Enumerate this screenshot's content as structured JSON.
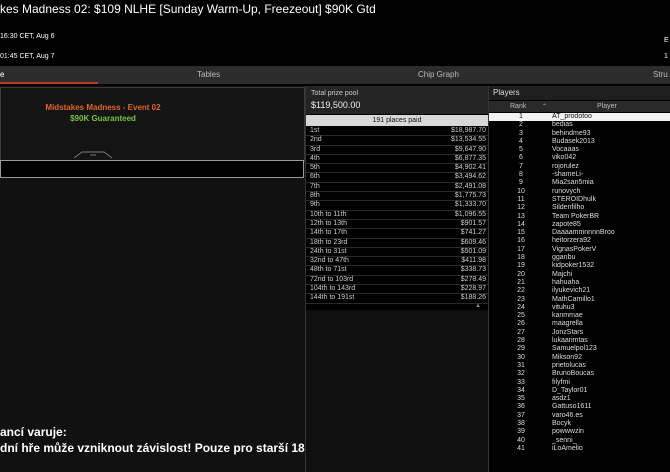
{
  "header": {
    "title": "kes Madness 02: $109 NLHE [Sunday Warm-Up, Freezeout] $90K Gtd",
    "start_time": "16:30 CET, Aug 6",
    "end_time": "01:45 CET, Aug 7",
    "right_label_1": "E",
    "right_label_2": "1"
  },
  "tabs": [
    {
      "label": "e"
    },
    {
      "label": "Tables"
    },
    {
      "label": "Chip Graph"
    },
    {
      "label": "Stru"
    }
  ],
  "event": {
    "name": "Midstakes Madness - Event 02",
    "guarantee": "$90K Guaranteed"
  },
  "warning": {
    "line1": "ancí varuje:",
    "line2": "dní hře může vzniknout závislost! Pouze pro starší 18 let!"
  },
  "prize": {
    "label": "Total prize pool",
    "value": "$119,500.00",
    "places_paid": "191 places paid",
    "payouts": [
      {
        "place": "1st",
        "amount": "$18,987.70"
      },
      {
        "place": "2nd",
        "amount": "$13,534.55"
      },
      {
        "place": "3rd",
        "amount": "$9,647.90"
      },
      {
        "place": "4th",
        "amount": "$6,877.35"
      },
      {
        "place": "5th",
        "amount": "$4,902.41"
      },
      {
        "place": "6th",
        "amount": "$3,494.62"
      },
      {
        "place": "7th",
        "amount": "$2,491.08"
      },
      {
        "place": "8th",
        "amount": "$1,775.73"
      },
      {
        "place": "9th",
        "amount": "$1,333.70"
      },
      {
        "place": "10th to 11th",
        "amount": "$1,096.55"
      },
      {
        "place": "12th to 13th",
        "amount": "$901.57"
      },
      {
        "place": "14th to 17th",
        "amount": "$741.27"
      },
      {
        "place": "18th to 23rd",
        "amount": "$609.46"
      },
      {
        "place": "24th to 31st",
        "amount": "$501.09"
      },
      {
        "place": "32nd to 47th",
        "amount": "$411.98"
      },
      {
        "place": "48th to 71st",
        "amount": "$338.73"
      },
      {
        "place": "72nd to 103rd",
        "amount": "$278.49"
      },
      {
        "place": "104th to 143rd",
        "amount": "$228.97"
      },
      {
        "place": "144th to 191st",
        "amount": "$188.26"
      }
    ]
  },
  "players": {
    "title": "Players",
    "col_rank": "Rank",
    "col_player": "Player",
    "rows": [
      {
        "rank": "1",
        "name": "AT_prodotoo"
      },
      {
        "rank": "2",
        "name": "bedias"
      },
      {
        "rank": "3",
        "name": "behindme93"
      },
      {
        "rank": "4",
        "name": "Budasek2013"
      },
      {
        "rank": "5",
        "name": "Vocaaas"
      },
      {
        "rank": "6",
        "name": "viko042"
      },
      {
        "rank": "7",
        "name": "rojorulez"
      },
      {
        "rank": "8",
        "name": "-shameLi-"
      },
      {
        "rank": "9",
        "name": "Mia2san5mia"
      },
      {
        "rank": "10",
        "name": "runovych"
      },
      {
        "rank": "11",
        "name": "STEROIDhulk"
      },
      {
        "rank": "12",
        "name": "Sildenfilho"
      },
      {
        "rank": "13",
        "name": "Team PokerBR"
      },
      {
        "rank": "14",
        "name": "zapote85"
      },
      {
        "rank": "15",
        "name": "DaaaammnnnnBroo"
      },
      {
        "rank": "16",
        "name": "heitorzera92"
      },
      {
        "rank": "17",
        "name": "VignasPokerV"
      },
      {
        "rank": "18",
        "name": "gganbu"
      },
      {
        "rank": "19",
        "name": "kidpoker1532"
      },
      {
        "rank": "20",
        "name": "Majchi"
      },
      {
        "rank": "21",
        "name": "hahuaha"
      },
      {
        "rank": "22",
        "name": "ilyukevich21"
      },
      {
        "rank": "23",
        "name": "MathCamillo1"
      },
      {
        "rank": "24",
        "name": "vituhu3"
      },
      {
        "rank": "25",
        "name": "kanmmae"
      },
      {
        "rank": "26",
        "name": "maagrella"
      },
      {
        "rank": "27",
        "name": "JonzStars"
      },
      {
        "rank": "28",
        "name": "lukaarimtas"
      },
      {
        "rank": "29",
        "name": "Samuelpol123"
      },
      {
        "rank": "30",
        "name": "Mikson92"
      },
      {
        "rank": "31",
        "name": "prietolucas"
      },
      {
        "rank": "32",
        "name": "BrunoBoucas"
      },
      {
        "rank": "33",
        "name": "filyfmi"
      },
      {
        "rank": "34",
        "name": "D_Taylor01"
      },
      {
        "rank": "35",
        "name": "asdz1"
      },
      {
        "rank": "36",
        "name": "Gattuso1611"
      },
      {
        "rank": "37",
        "name": "varo46.es"
      },
      {
        "rank": "38",
        "name": "Bocyk"
      },
      {
        "rank": "39",
        "name": "powwwzin"
      },
      {
        "rank": "40",
        "name": "_senni_"
      },
      {
        "rank": "41",
        "name": "iLoAmelio"
      }
    ]
  }
}
